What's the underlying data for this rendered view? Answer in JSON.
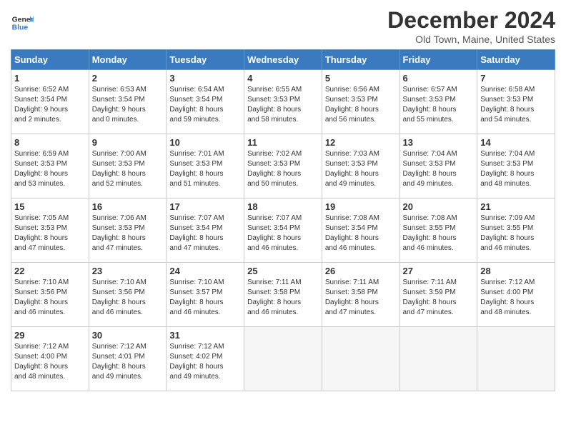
{
  "header": {
    "logo_line1": "General",
    "logo_line2": "Blue",
    "title": "December 2024",
    "location": "Old Town, Maine, United States"
  },
  "days_of_week": [
    "Sunday",
    "Monday",
    "Tuesday",
    "Wednesday",
    "Thursday",
    "Friday",
    "Saturday"
  ],
  "weeks": [
    [
      {
        "day": 1,
        "info": "Sunrise: 6:52 AM\nSunset: 3:54 PM\nDaylight: 9 hours\nand 2 minutes."
      },
      {
        "day": 2,
        "info": "Sunrise: 6:53 AM\nSunset: 3:54 PM\nDaylight: 9 hours\nand 0 minutes."
      },
      {
        "day": 3,
        "info": "Sunrise: 6:54 AM\nSunset: 3:54 PM\nDaylight: 8 hours\nand 59 minutes."
      },
      {
        "day": 4,
        "info": "Sunrise: 6:55 AM\nSunset: 3:53 PM\nDaylight: 8 hours\nand 58 minutes."
      },
      {
        "day": 5,
        "info": "Sunrise: 6:56 AM\nSunset: 3:53 PM\nDaylight: 8 hours\nand 56 minutes."
      },
      {
        "day": 6,
        "info": "Sunrise: 6:57 AM\nSunset: 3:53 PM\nDaylight: 8 hours\nand 55 minutes."
      },
      {
        "day": 7,
        "info": "Sunrise: 6:58 AM\nSunset: 3:53 PM\nDaylight: 8 hours\nand 54 minutes."
      }
    ],
    [
      {
        "day": 8,
        "info": "Sunrise: 6:59 AM\nSunset: 3:53 PM\nDaylight: 8 hours\nand 53 minutes."
      },
      {
        "day": 9,
        "info": "Sunrise: 7:00 AM\nSunset: 3:53 PM\nDaylight: 8 hours\nand 52 minutes."
      },
      {
        "day": 10,
        "info": "Sunrise: 7:01 AM\nSunset: 3:53 PM\nDaylight: 8 hours\nand 51 minutes."
      },
      {
        "day": 11,
        "info": "Sunrise: 7:02 AM\nSunset: 3:53 PM\nDaylight: 8 hours\nand 50 minutes."
      },
      {
        "day": 12,
        "info": "Sunrise: 7:03 AM\nSunset: 3:53 PM\nDaylight: 8 hours\nand 49 minutes."
      },
      {
        "day": 13,
        "info": "Sunrise: 7:04 AM\nSunset: 3:53 PM\nDaylight: 8 hours\nand 49 minutes."
      },
      {
        "day": 14,
        "info": "Sunrise: 7:04 AM\nSunset: 3:53 PM\nDaylight: 8 hours\nand 48 minutes."
      }
    ],
    [
      {
        "day": 15,
        "info": "Sunrise: 7:05 AM\nSunset: 3:53 PM\nDaylight: 8 hours\nand 47 minutes."
      },
      {
        "day": 16,
        "info": "Sunrise: 7:06 AM\nSunset: 3:53 PM\nDaylight: 8 hours\nand 47 minutes."
      },
      {
        "day": 17,
        "info": "Sunrise: 7:07 AM\nSunset: 3:54 PM\nDaylight: 8 hours\nand 47 minutes."
      },
      {
        "day": 18,
        "info": "Sunrise: 7:07 AM\nSunset: 3:54 PM\nDaylight: 8 hours\nand 46 minutes."
      },
      {
        "day": 19,
        "info": "Sunrise: 7:08 AM\nSunset: 3:54 PM\nDaylight: 8 hours\nand 46 minutes."
      },
      {
        "day": 20,
        "info": "Sunrise: 7:08 AM\nSunset: 3:55 PM\nDaylight: 8 hours\nand 46 minutes."
      },
      {
        "day": 21,
        "info": "Sunrise: 7:09 AM\nSunset: 3:55 PM\nDaylight: 8 hours\nand 46 minutes."
      }
    ],
    [
      {
        "day": 22,
        "info": "Sunrise: 7:10 AM\nSunset: 3:56 PM\nDaylight: 8 hours\nand 46 minutes."
      },
      {
        "day": 23,
        "info": "Sunrise: 7:10 AM\nSunset: 3:56 PM\nDaylight: 8 hours\nand 46 minutes."
      },
      {
        "day": 24,
        "info": "Sunrise: 7:10 AM\nSunset: 3:57 PM\nDaylight: 8 hours\nand 46 minutes."
      },
      {
        "day": 25,
        "info": "Sunrise: 7:11 AM\nSunset: 3:58 PM\nDaylight: 8 hours\nand 46 minutes."
      },
      {
        "day": 26,
        "info": "Sunrise: 7:11 AM\nSunset: 3:58 PM\nDaylight: 8 hours\nand 47 minutes."
      },
      {
        "day": 27,
        "info": "Sunrise: 7:11 AM\nSunset: 3:59 PM\nDaylight: 8 hours\nand 47 minutes."
      },
      {
        "day": 28,
        "info": "Sunrise: 7:12 AM\nSunset: 4:00 PM\nDaylight: 8 hours\nand 48 minutes."
      }
    ],
    [
      {
        "day": 29,
        "info": "Sunrise: 7:12 AM\nSunset: 4:00 PM\nDaylight: 8 hours\nand 48 minutes."
      },
      {
        "day": 30,
        "info": "Sunrise: 7:12 AM\nSunset: 4:01 PM\nDaylight: 8 hours\nand 49 minutes."
      },
      {
        "day": 31,
        "info": "Sunrise: 7:12 AM\nSunset: 4:02 PM\nDaylight: 8 hours\nand 49 minutes."
      },
      null,
      null,
      null,
      null
    ]
  ]
}
